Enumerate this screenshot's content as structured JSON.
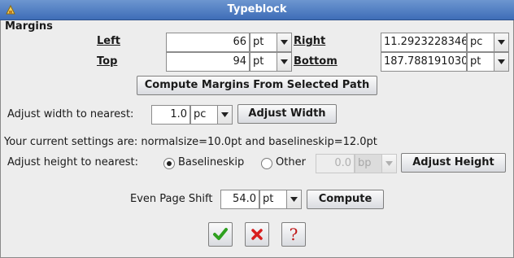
{
  "window": {
    "title": "Typeblock"
  },
  "margins": {
    "heading": "Margins",
    "left": {
      "label": "Left",
      "value": "66",
      "unit": "pt"
    },
    "right": {
      "label": "Right",
      "value": "11.2923228346",
      "unit": "pc"
    },
    "top": {
      "label": "Top",
      "value": "94",
      "unit": "pt"
    },
    "bottom": {
      "label": "Bottom",
      "value": "187.788191030",
      "unit": "pt"
    },
    "compute_button": "Compute Margins From Selected Path"
  },
  "width": {
    "label": "Adjust width to nearest:",
    "value": "1.0",
    "unit": "pc",
    "button": "Adjust Width"
  },
  "settings_text": "Your current settings are: normalsize=10.0pt and baselineskip=12.0pt",
  "height": {
    "label": "Adjust height to nearest:",
    "option_baselineskip": "Baselineskip",
    "option_other": "Other",
    "other_value": "0.0",
    "other_unit": "bp",
    "selected": "Baselineskip",
    "button": "Adjust Height"
  },
  "shift": {
    "label": "Even Page Shift",
    "value": "54.0",
    "unit": "pt",
    "button": "Compute"
  },
  "dialog_buttons": {
    "ok_icon": "check-icon",
    "cancel_icon": "cross-icon",
    "help_icon": "question-icon",
    "help_glyph": "?"
  },
  "colors": {
    "titlebar": "#4a78c0",
    "ok": "#2ea01f",
    "cancel": "#d81e1e",
    "help": "#c01818"
  }
}
